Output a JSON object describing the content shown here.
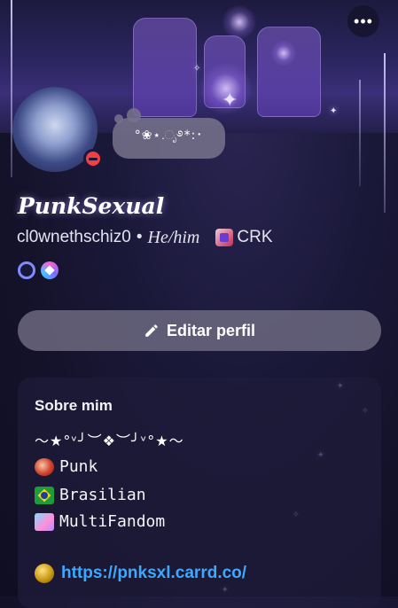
{
  "header": {
    "more_icon": "ellipsis-icon",
    "more_label": "•••"
  },
  "profile": {
    "status_text": "°❀⋆.ೃ࿔*:･",
    "display_name": "PunkSexual",
    "username": "cl0wnethschiz0",
    "separator": "•",
    "pronouns": "He/him",
    "clan_tag": "CRK",
    "status": "do-not-disturb",
    "badges": [
      "nitro-badge",
      "boost-badge"
    ]
  },
  "actions": {
    "edit_label": "Editar perfil",
    "edit_icon": "pencil-icon"
  },
  "about": {
    "title": "Sobre mim",
    "decoration": "〜★°ᵛ╯︶❖︶╯ᵛ°★〜",
    "lines": [
      {
        "icon": "spartan-helmet-icon",
        "text": "Punk"
      },
      {
        "icon": "brazil-flag-icon",
        "text": "Brasilian"
      },
      {
        "icon": "cube-icon",
        "text": "MultiFandom"
      }
    ],
    "link_icon": "gold-nugget-icon",
    "link": "https://pnksxl.carrd.co/"
  },
  "colors": {
    "background": "#141229",
    "link": "#3ea8ff",
    "dnd": "#f23f43",
    "button": "#6c6880"
  }
}
